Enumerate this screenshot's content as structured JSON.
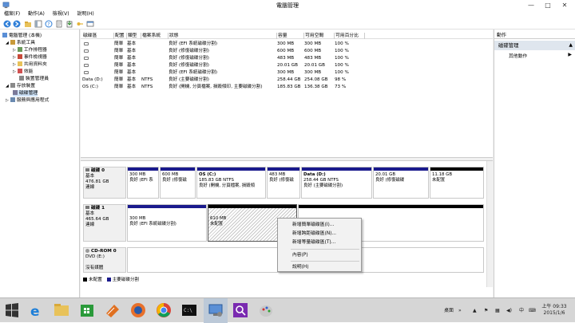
{
  "window": {
    "title": "電腦管理"
  },
  "menu": [
    "檔案(F)",
    "動作(A)",
    "檢視(V)",
    "說明(H)"
  ],
  "tree": {
    "root": "電腦管理 (本機)",
    "items": [
      {
        "label": "系統工具",
        "level": 1
      },
      {
        "label": "工作排程器",
        "level": 2
      },
      {
        "label": "事件檢視器",
        "level": 2
      },
      {
        "label": "共用資料夾",
        "level": 2
      },
      {
        "label": "效能",
        "level": 2
      },
      {
        "label": "裝置管理員",
        "level": 2
      },
      {
        "label": "存放裝置",
        "level": 1
      },
      {
        "label": "磁碟管理",
        "level": 2
      },
      {
        "label": "服務與應用程式",
        "level": 1
      }
    ]
  },
  "volumes": {
    "headers": [
      "磁碟區",
      "配置",
      "類型",
      "檔案系統",
      "狀態",
      "容量",
      "可用空間",
      "可用百分比"
    ],
    "rows": [
      {
        "name": "",
        "layout": "簡單",
        "type": "基本",
        "fs": "",
        "status": "良好 (EFI 系統磁碟分割)",
        "capacity": "300 MB",
        "free": "300 MB",
        "pct": "100 %"
      },
      {
        "name": "",
        "layout": "簡單",
        "type": "基本",
        "fs": "",
        "status": "良好 (修復磁碟分割)",
        "capacity": "600 MB",
        "free": "600 MB",
        "pct": "100 %"
      },
      {
        "name": "",
        "layout": "簡單",
        "type": "基本",
        "fs": "",
        "status": "良好 (修復磁碟分割)",
        "capacity": "483 MB",
        "free": "483 MB",
        "pct": "100 %"
      },
      {
        "name": "",
        "layout": "簡單",
        "type": "基本",
        "fs": "",
        "status": "良好 (修復磁碟分割)",
        "capacity": "20.01 GB",
        "free": "20.01 GB",
        "pct": "100 %"
      },
      {
        "name": "",
        "layout": "簡單",
        "type": "基本",
        "fs": "",
        "status": "良好 (EFI 系統磁碟分割)",
        "capacity": "300 MB",
        "free": "300 MB",
        "pct": "100 %"
      },
      {
        "name": "Data (D:)",
        "layout": "簡單",
        "type": "基本",
        "fs": "NTFS",
        "status": "良好 (主要磁碟分割)",
        "capacity": "258.44 GB",
        "free": "254.08 GB",
        "pct": "98 %"
      },
      {
        "name": "OS (C:)",
        "layout": "簡單",
        "type": "基本",
        "fs": "NTFS",
        "status": "良好 (開機, 分頁檔案, 損毀傾印, 主要磁碟分割)",
        "capacity": "185.83 GB",
        "free": "136.38 GB",
        "pct": "73 %"
      }
    ]
  },
  "disks": [
    {
      "name": "磁碟 0",
      "type": "基本",
      "size": "476.81 GB",
      "status": "連線",
      "partitions": [
        {
          "line1": "300 MB",
          "line2": "良好 (EFI 系",
          "kind": "primary"
        },
        {
          "line1": "600 MB",
          "line2": "良好 (修復磁",
          "kind": "primary"
        },
        {
          "line1": "OS (C:)",
          "line1b": "185.83 GB NTFS",
          "line2": "良好 (開機, 分頁檔案, 損毀傾",
          "kind": "primary",
          "bold": true
        },
        {
          "line1": "483 MB",
          "line2": "良好 (修復磁",
          "kind": "primary"
        },
        {
          "line1": "Data (D:)",
          "line1b": "258.44 GB NTFS",
          "line2": "良好 (主要磁碟分割)",
          "kind": "primary",
          "bold": true
        },
        {
          "line1": "20.01 GB",
          "line2": "良好 (修復磁碟",
          "kind": "primary"
        },
        {
          "line1": "11.18 GB",
          "line2": "未配置",
          "kind": "unalloc"
        }
      ]
    },
    {
      "name": "磁碟 1",
      "type": "基本",
      "size": "465.64 GB",
      "status": "連線",
      "partitions": [
        {
          "line1": "300 MB",
          "line2": "良好 (EFI 系統磁碟分割)",
          "kind": "primary"
        },
        {
          "line1": "610 MB",
          "line2": "未配置",
          "kind": "unalloc-selected"
        },
        {
          "line1": "",
          "line2": "",
          "kind": "unalloc"
        }
      ]
    },
    {
      "name": "CD-ROM 0",
      "type": "DVD (E:)",
      "size": "",
      "status": "沒有媒體",
      "partitions": []
    }
  ],
  "legend": [
    "未配置",
    "主要磁碟分割"
  ],
  "actions": {
    "header": "動作",
    "section": "磁碟管理",
    "item": "其他動作"
  },
  "context_menu": [
    "新增簡單磁碟區(I)...",
    "新增跨距磁碟區(N)...",
    "新增等量磁碟區(T)...",
    "內容(P)",
    "說明(H)"
  ],
  "taskbar": {
    "tray_label": "桌面",
    "time": "上午 09:33",
    "date": "2015/1/6"
  },
  "colors": {
    "primary_partition": "#1a1a8c",
    "unallocated": "#000000",
    "selection": "#dfe6ee"
  }
}
